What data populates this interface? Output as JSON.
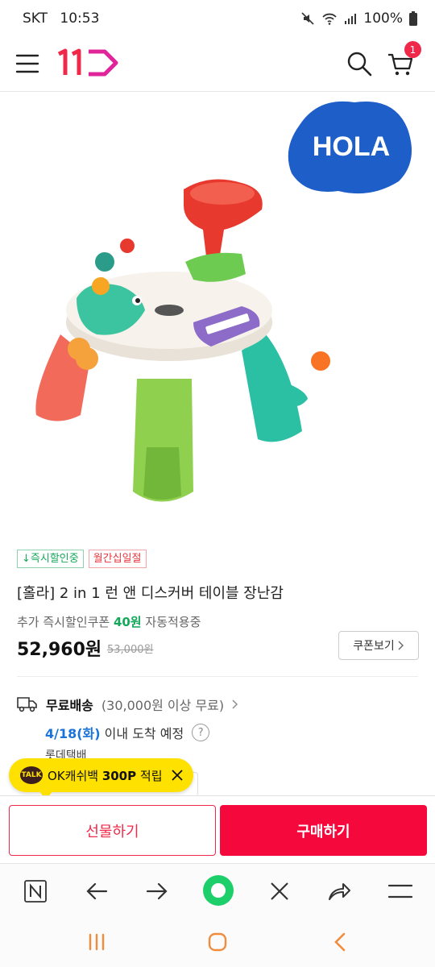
{
  "status_bar": {
    "carrier": "SKT",
    "time": "10:53",
    "battery": "100%"
  },
  "header": {
    "logo_text": "11",
    "cart_count": "1"
  },
  "product": {
    "brand_logo": "HOLA",
    "badges": [
      {
        "label": "↓즉시할인중"
      },
      {
        "label": "월간십일절"
      }
    ],
    "title": "[홀라] 2 in 1 런 앤 디스커버 테이블 장난감",
    "coupon_prefix": "추가 즉시할인쿠폰 ",
    "coupon_amount": "40원",
    "coupon_suffix": " 자동적용중",
    "price": "52,960원",
    "original_price": "53,000원",
    "coupon_button": "쿠폰보기"
  },
  "shipping": {
    "free_label": "무료배송",
    "condition": "(30,000원 이상 무료)",
    "arrival_date": "4/18(화)",
    "arrival_text": " 이내 도착 예정",
    "help": "?",
    "carrier": "롯데택배"
  },
  "tooltip": {
    "talk": "TALK",
    "prefix": "OK캐쉬백 ",
    "points": "300P",
    "suffix": " 적립"
  },
  "actions": {
    "gift": "선물하기",
    "buy": "구매하기"
  },
  "colors": {
    "brand_red": "#f5093c",
    "green": "#15a85b",
    "blue": "#1a73d9",
    "tooltip_yellow": "#ffe100"
  }
}
